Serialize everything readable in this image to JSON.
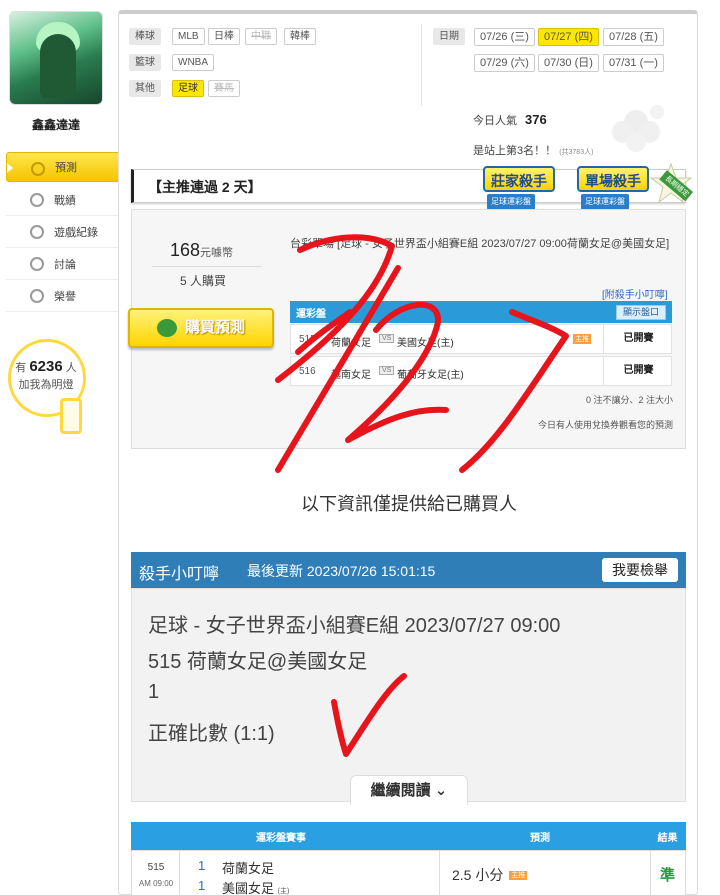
{
  "user": {
    "name": "鑫鑫達達"
  },
  "nav": [
    {
      "label": "預測",
      "icon": "target-icon",
      "active": true
    },
    {
      "label": "戰績",
      "icon": "chat-icon"
    },
    {
      "label": "遊戲紀錄",
      "icon": "record-icon"
    },
    {
      "label": "討論",
      "icon": "discuss-icon"
    },
    {
      "label": "榮譽",
      "icon": "award-icon"
    }
  ],
  "fans": {
    "prefix": "有",
    "count": "6236",
    "suffix": "人",
    "line2": "加我為明燈"
  },
  "filters": {
    "baseball": {
      "label": "棒球",
      "items": [
        "MLB",
        "日棒",
        "中職",
        "韓棒"
      ]
    },
    "basketball": {
      "label": "籃球",
      "items": [
        "WNBA"
      ]
    },
    "other": {
      "label": "其他",
      "items": [
        "足球",
        "賽馬"
      ]
    }
  },
  "dates": {
    "label": "日期",
    "items": [
      "07/26 (三)",
      "07/27 (四)",
      "07/28 (五)",
      "07/29 (六)",
      "07/30 (日)",
      "07/31 (一)"
    ],
    "selected": "07/27 (四)"
  },
  "stats": {
    "pop_label": "今日人氣",
    "pop_value": "376",
    "rank": "是站上第3名！！",
    "rank_small": "(共3783人)"
  },
  "streak": {
    "text": "【主推連過 2 天】",
    "badge1": "莊家殺手",
    "badge1_ribbon": "足球運彩盤",
    "badge2": "單場殺手",
    "badge2_ribbon": "足球運彩盤",
    "badge3": "長期穩定"
  },
  "prediction": {
    "price": "168",
    "price_unit": "元噱幣",
    "buyers": "5 人購買",
    "buy_label": "購買預測",
    "game_title": "台彩單場 [足球 - 女子世界盃小組賽E組 2023/07/27 09:00荷蘭女足@美國女足]",
    "helper_link": "[附殺手小叮嚀]",
    "table_title": "運彩盤",
    "show_btn": "顯示盤口",
    "rows": [
      {
        "no": "515",
        "team1": "荷蘭女足",
        "vs": "VS",
        "team2": "美國女足(主)",
        "tag": "主推",
        "status": "已開賽"
      },
      {
        "no": "516",
        "team1": "越南女足",
        "vs": "VS",
        "team2": "葡萄牙女足(主)",
        "tag": "",
        "status": "已開賽"
      }
    ],
    "note1": "0 注不讓分、2 注大小",
    "note2": "今日有人使用兌換券觀看您的預測"
  },
  "info_text": "以下資訊僅提供給已購買人",
  "killer": {
    "title": "殺手小叮嚀",
    "updated": "最後更新 2023/07/26 15:01:15",
    "report_btn": "我要檢舉",
    "line1": "足球 - 女子世界盃小組賽E組 2023/07/27 09:00",
    "line2": "515 荷蘭女足@美國女足",
    "line3": "1",
    "line4": "正確比數 (1:1)",
    "more_btn": "繼續閱讀"
  },
  "result_table": {
    "headers": [
      "運彩盤賽事",
      "預測",
      "結果"
    ],
    "row": {
      "no": "515",
      "time": "AM 09:00",
      "score1": "1",
      "team1": "荷蘭女足",
      "score2": "1",
      "team2": "美國女足",
      "home": "(主)",
      "pred": "2.5 小分",
      "tag": "主推",
      "result": "準"
    }
  },
  "handwriting": "7/27"
}
